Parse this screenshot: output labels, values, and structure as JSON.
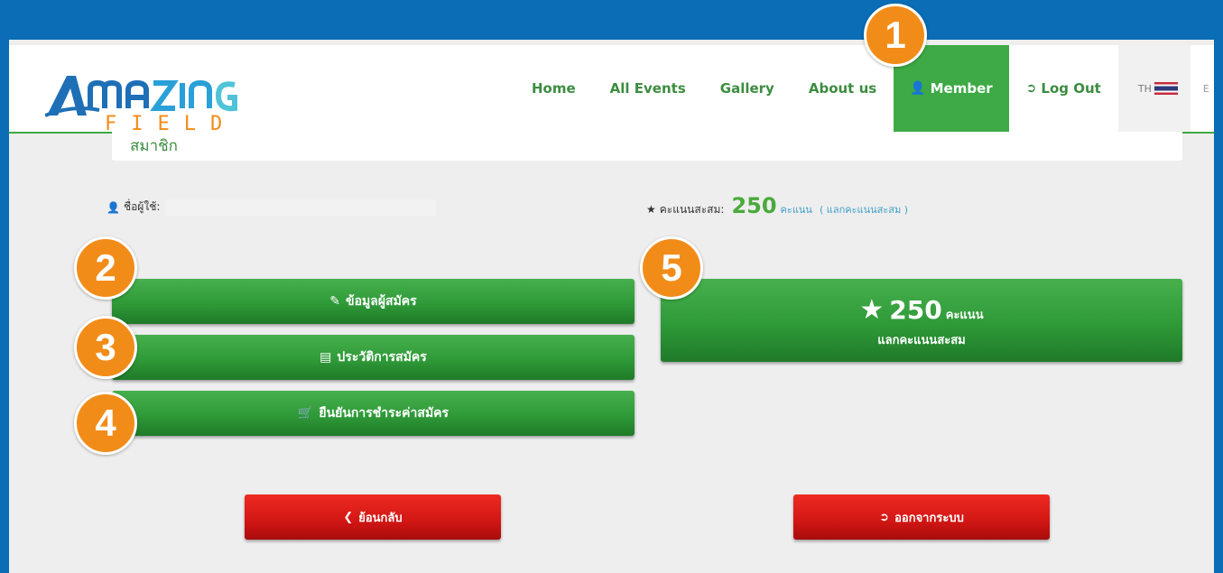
{
  "header": {
    "nav": [
      "Home",
      "All Events",
      "Gallery",
      "About us"
    ],
    "member": "Member",
    "logout": "Log Out",
    "lang_th": "TH",
    "lang_en": "E"
  },
  "page_title": "สมาชิก",
  "user": {
    "label": "ชื่อผู้ใช้:"
  },
  "points": {
    "label": "คะแนนสะสม:",
    "value": "250",
    "unit": "คะแนน",
    "link": "( แลกคะแนนสะสม )"
  },
  "buttons": {
    "profile": "ข้อมูลผู้สมัคร",
    "history": "ประวัติการสมัคร",
    "payment": "ยืนยันการชำระค่าสมัคร",
    "redeem_value": "250",
    "redeem_unit": "คะแนน",
    "redeem_label": "แลกคะแนนสะสม",
    "back": "ย้อนกลับ",
    "signout": "ออกจากระบบ"
  },
  "badges": [
    "1",
    "2",
    "3",
    "4",
    "5"
  ],
  "colors": {
    "brand_green": "#3daa45",
    "accent_orange": "#f28c19",
    "danger_red": "#d11614",
    "frame_blue": "#0a6db5"
  },
  "icons": [
    "user-icon",
    "logout-icon",
    "pencil-icon",
    "list-icon",
    "cart-icon",
    "star-icon",
    "chevron-left-icon"
  ]
}
